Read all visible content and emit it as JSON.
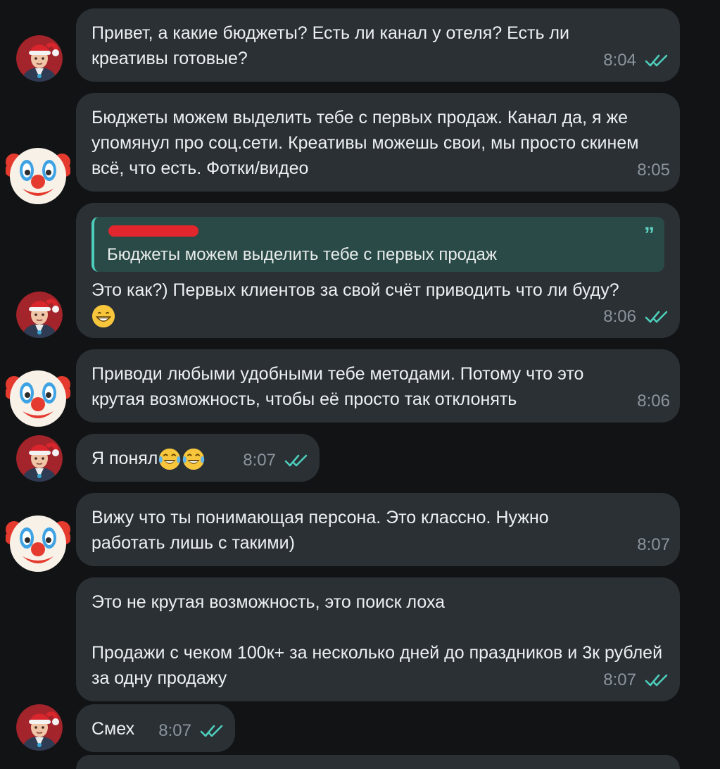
{
  "messages": [
    {
      "text": "Привет, а какие бюджеты? Есть ли канал у отеля? Есть ли креативы готовые?",
      "time": "8:04"
    },
    {
      "text": "Бюджеты можем выделить тебе с первых продаж. Канал да, я же упомянул про соц.сети. Креативы можешь свои, мы просто скинем всё, что есть. Фотки/видео",
      "time": "8:05"
    },
    {
      "reply_text": "Бюджеты можем выделить тебе с первых продаж",
      "text": "Это как?) Первых клиентов за свой счёт приводить что ли буду?",
      "time": "8:06"
    },
    {
      "text": "Приводи любыми удобными тебе методами. Потому что это крутая возможность, чтобы её просто так отклонять",
      "time": "8:06"
    },
    {
      "text": "Я понял",
      "time": "8:07"
    },
    {
      "text": "Вижу что ты понимающая персона. Это классно. Нужно работать лишь с такими)",
      "time": "8:07"
    },
    {
      "text": "Это не крутая возможность, это поиск лоха\n\nПродажи с чеком 100к+ за несколько дней до праздников и 3к рублей за одну продажу",
      "time": "8:07"
    },
    {
      "text": "Смех",
      "time": "8:07"
    }
  ],
  "colors": {
    "background": "#111315",
    "bubble": "#2b3035",
    "check": "#4dcdbb",
    "time": "#8b949c"
  },
  "icons": [
    "santa-avatar-icon",
    "clown-face-icon",
    "double-check-icon",
    "grinning-emoji-icon",
    "tears-of-joy-emoji-icon",
    "quote-icon"
  ]
}
